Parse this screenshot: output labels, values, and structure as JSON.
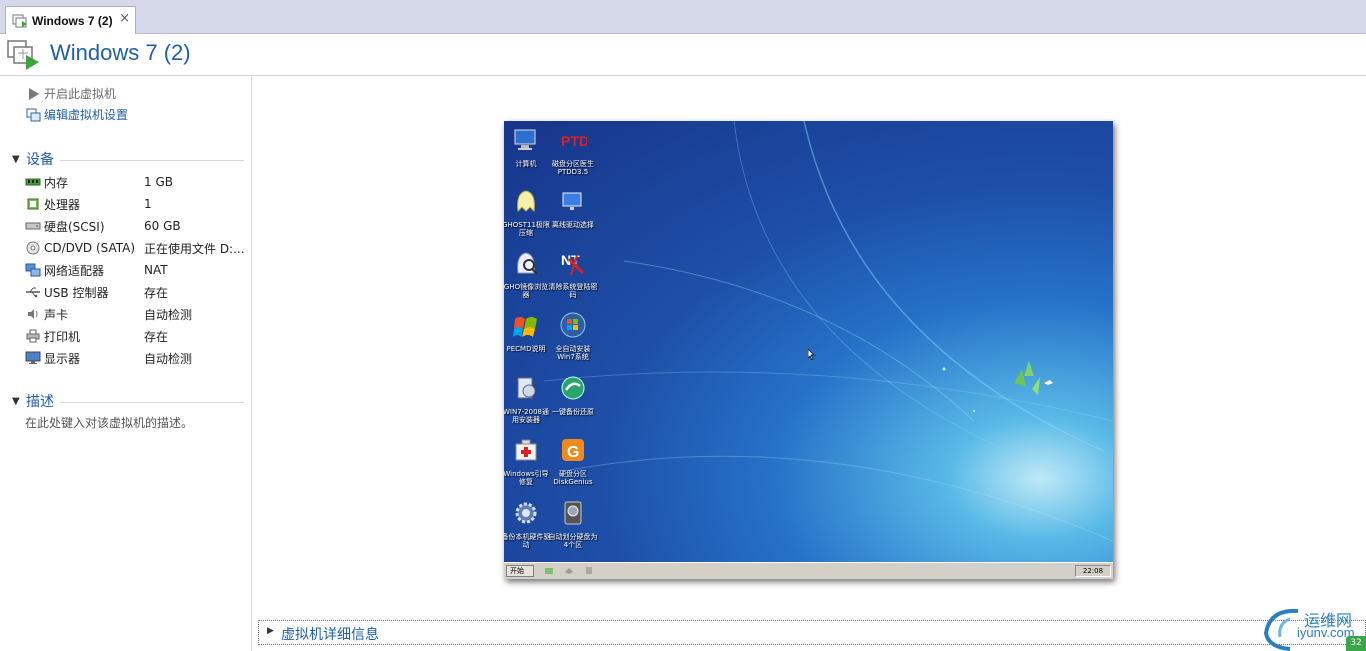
{
  "tab": {
    "title": "Windows 7 (2)",
    "close": "×"
  },
  "header": {
    "title": "Windows 7 (2)"
  },
  "actions": {
    "start": "开启此虚拟机",
    "edit": "编辑虚拟机设置"
  },
  "devices": {
    "heading": "设备",
    "items": [
      {
        "icon": "memory-icon",
        "name": "内存",
        "value": "1 GB"
      },
      {
        "icon": "processor-icon",
        "name": "处理器",
        "value": "1"
      },
      {
        "icon": "hard-disk-icon",
        "name": "硬盘(SCSI)",
        "value": "60 GB"
      },
      {
        "icon": "cd-dvd-icon",
        "name": "CD/DVD (SATA)",
        "value": "正在使用文件 D:..."
      },
      {
        "icon": "network-adapter-icon",
        "name": "网络适配器",
        "value": "NAT"
      },
      {
        "icon": "usb-icon",
        "name": "USB 控制器",
        "value": "存在"
      },
      {
        "icon": "sound-card-icon",
        "name": "声卡",
        "value": "自动检测"
      },
      {
        "icon": "printer-icon",
        "name": "打印机",
        "value": "存在"
      },
      {
        "icon": "display-icon",
        "name": "显示器",
        "value": "自动检测"
      }
    ]
  },
  "description": {
    "heading": "描述",
    "text": "在此处键入对该虚拟机的描述。"
  },
  "details": {
    "label": "虚拟机详细信息"
  },
  "desktop": {
    "icons": [
      {
        "icon": "computer-icon",
        "label": "计算机"
      },
      {
        "icon": "ptd-icon",
        "label": "磁盘分区医生PTDD3.5"
      },
      {
        "icon": "ghost-icon",
        "label": "GHOST11极限压缩"
      },
      {
        "icon": "monitor-icon",
        "label": "离线驱动选择"
      },
      {
        "icon": "gho-browser-icon",
        "label": "GHO镜像浏览器"
      },
      {
        "icon": "nt-password-icon",
        "label": "清除系统登陆密码"
      },
      {
        "icon": "pecmd-icon",
        "label": "PECMD说明"
      },
      {
        "icon": "win7-install-icon",
        "label": "全自动安装Win7系统"
      },
      {
        "icon": "win-installer-icon",
        "label": "WIN7-2008通用安装器"
      },
      {
        "icon": "backup-restore-icon",
        "label": "一键备份还原"
      },
      {
        "icon": "windows-boot-repair-icon",
        "label": "Windows引导修复"
      },
      {
        "icon": "diskgenius-icon",
        "label": "硬盘分区DiskGenius"
      },
      {
        "icon": "driver-backup-icon",
        "label": "备份本机硬件驱动"
      },
      {
        "icon": "auto-partition-icon",
        "label": "自动划分硬盘为4个区"
      }
    ],
    "start": "开始",
    "clock": "22:08"
  },
  "watermark": {
    "line1": "运维网",
    "line2": "iyunv.com",
    "badge": "32"
  }
}
